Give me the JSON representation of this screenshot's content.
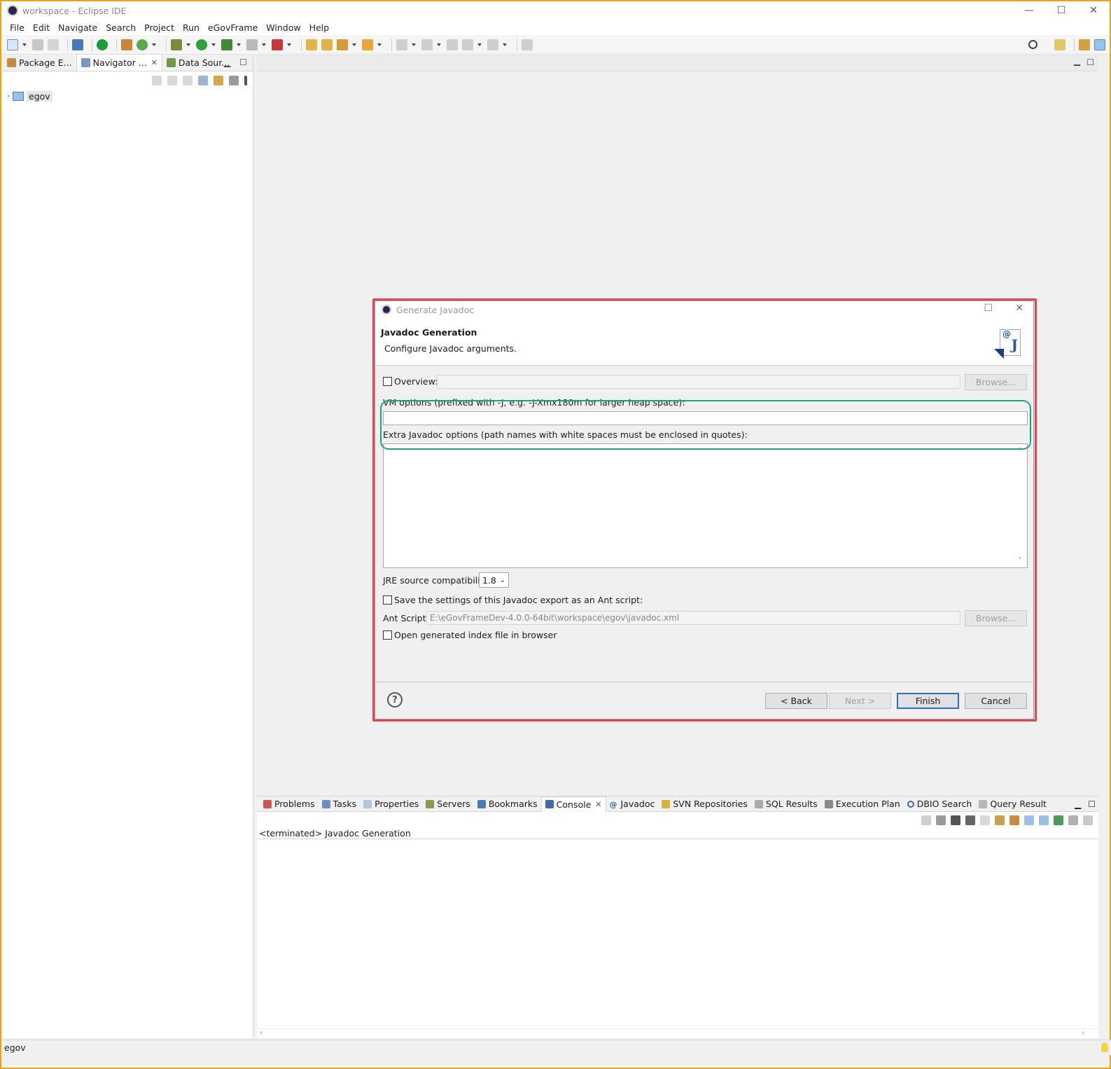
{
  "window": {
    "title": "workspace - Eclipse IDE",
    "controls": {
      "minimize": "—",
      "maximize": "☐",
      "close": "✕"
    }
  },
  "menu": [
    "File",
    "Edit",
    "Navigate",
    "Search",
    "Project",
    "Run",
    "eGovFrame",
    "Window",
    "Help"
  ],
  "left_panel": {
    "tabs": [
      {
        "label": "Package E...",
        "icon": "package-explorer-icon"
      },
      {
        "label": "Navigator ...",
        "icon": "navigator-icon",
        "close": "✕"
      },
      {
        "label": "Data Sour...",
        "icon": "data-source-icon"
      }
    ],
    "tree": [
      {
        "expander": "›",
        "label": "egov",
        "icon": "project-folder-icon"
      }
    ]
  },
  "dialog": {
    "title": "Generate Javadoc",
    "heading": "Javadoc Generation",
    "subheading": "Configure Javadoc arguments.",
    "overview_label": "Overview:",
    "overview_browse": "Browse...",
    "vm_options_label": "VM options (prefixed with -J, e.g. -J-Xmx180m for larger heap space):",
    "vm_options_value": "",
    "extra_options_label": "Extra Javadoc options (path names with white spaces must be enclosed in quotes):",
    "extra_options_value": "",
    "jre_label": "JRE source compatibility:",
    "jre_value": "1.8",
    "save_ant_label": "Save the settings of this Javadoc export as an Ant script:",
    "ant_script_label": "Ant Script:",
    "ant_script_value": "E:\\eGovFrameDev-4.0.0-64bit\\workspace\\egov\\javadoc.xml",
    "ant_browse": "Browse...",
    "open_index_label": "Open generated index file in browser",
    "buttons": {
      "back": "< Back",
      "next": "Next >",
      "finish": "Finish",
      "cancel": "Cancel"
    },
    "help": "?"
  },
  "bottom_panel": {
    "tabs": [
      {
        "label": "Problems",
        "icon": "problems-icon"
      },
      {
        "label": "Tasks",
        "icon": "tasks-icon"
      },
      {
        "label": "Properties",
        "icon": "properties-icon"
      },
      {
        "label": "Servers",
        "icon": "servers-icon"
      },
      {
        "label": "Bookmarks",
        "icon": "bookmarks-icon"
      },
      {
        "label": "Console",
        "icon": "console-icon",
        "active": true,
        "close": "✕"
      },
      {
        "label": "Javadoc",
        "icon": "javadoc-icon"
      },
      {
        "label": "SVN Repositories",
        "icon": "svn-icon"
      },
      {
        "label": "SQL Results",
        "icon": "sql-results-icon"
      },
      {
        "label": "Execution Plan",
        "icon": "execution-plan-icon"
      },
      {
        "label": "DBIO Search",
        "icon": "dbio-search-icon"
      },
      {
        "label": "Query Result",
        "icon": "query-result-icon"
      }
    ],
    "console_label": "<terminated> Javadoc Generation"
  },
  "status": {
    "selection": "egov"
  },
  "colors": {
    "highlight_red": "#e04752",
    "highlight_green": "#1fa085",
    "window_border": "#e8a317"
  }
}
